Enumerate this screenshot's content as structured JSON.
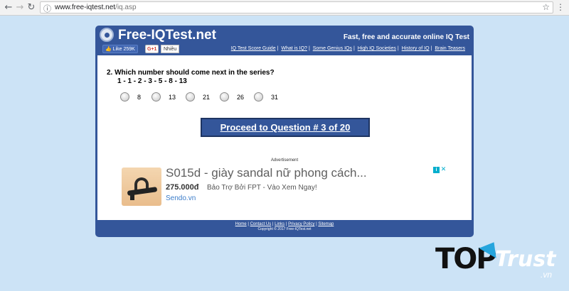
{
  "browser": {
    "url_host": "www.free-iqtest.net",
    "url_path": "/iq.asp",
    "icons": {
      "back": "back-arrow-icon",
      "forward": "forward-arrow-icon",
      "reload": "reload-icon",
      "info": "info-icon",
      "star": "bookmark-star-icon",
      "menu": "menu-dots-icon"
    }
  },
  "site": {
    "logo": "Free-IQTest.net",
    "tagline": "Fast, free and accurate online IQ Test",
    "social": {
      "fb_like": "Like 259K",
      "gplus": "G+1",
      "gplus_label": "Nhiều"
    },
    "links": [
      "IQ Test Score Guide",
      "What is IQ?",
      "Some Genius IQs",
      "High IQ Societies",
      "History of IQ",
      "Brain Teasers"
    ],
    "colors": {
      "frame": "#34569a",
      "background": "#cce3f6"
    }
  },
  "quiz": {
    "question": "2.  Which number should come next in the series?",
    "series": "1 - 1 - 2 - 3 - 5 - 8 - 13",
    "options": [
      "8",
      "13",
      "21",
      "26",
      "31"
    ],
    "proceed": "Proceed to Question # 3 of 20"
  },
  "ad": {
    "label": "Advertisement",
    "title": "S015d - giày sandal nữ phong cách...",
    "price": "275.000đ",
    "desc": "Bảo Trợ Bởi FPT - Vào Xem Ngay!",
    "source": "Sendo.vn"
  },
  "footer": {
    "links": [
      "Home",
      "Contact Us",
      "Links",
      "Privacy Policy",
      "Sitemap"
    ],
    "copyright": "Copyright © 2017 Free-IQTest.net"
  },
  "watermark": {
    "top": "TOP",
    "trust": "Trust",
    "vn": ".vn"
  }
}
